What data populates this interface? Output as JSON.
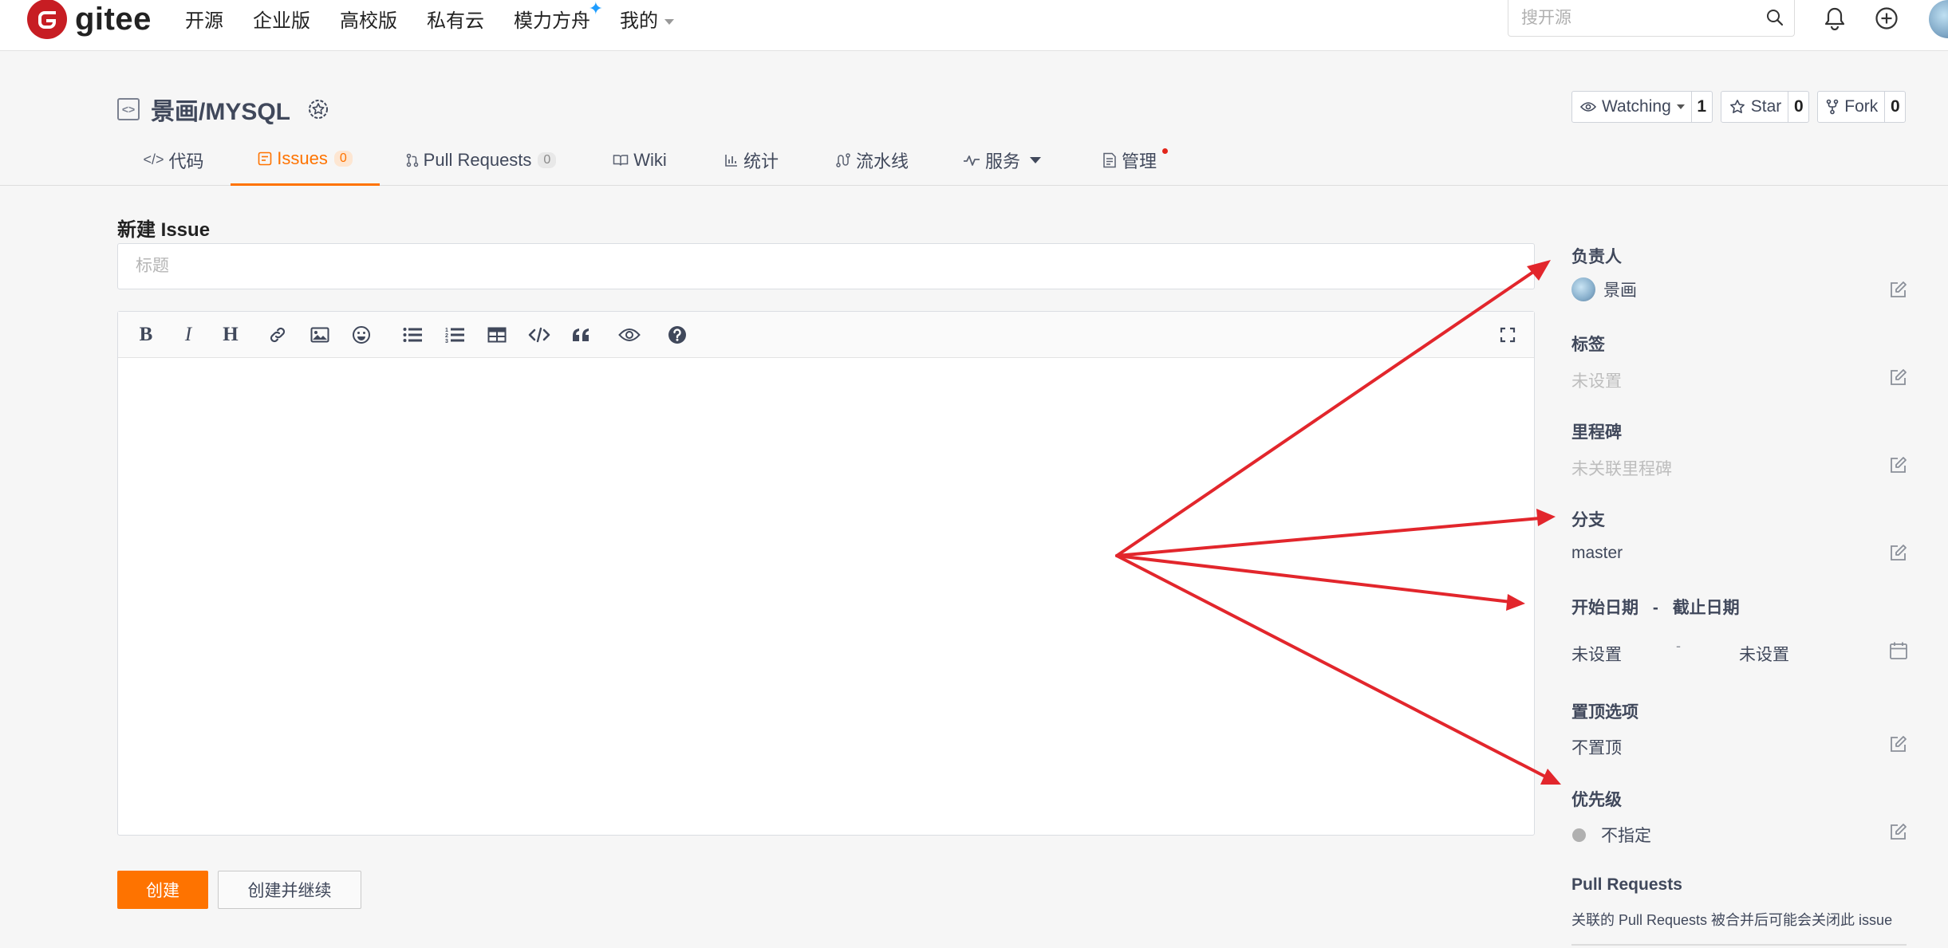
{
  "nav": {
    "logo_text": "gitee",
    "links": [
      "开源",
      "企业版",
      "高校版",
      "私有云",
      "模力方舟",
      "我的"
    ],
    "search_placeholder": "搜开源"
  },
  "repo": {
    "title": "景画/MYSQL",
    "watch_label": "Watching",
    "watch_count": "1",
    "star_label": "Star",
    "star_count": "0",
    "fork_label": "Fork",
    "fork_count": "0"
  },
  "tabs": [
    {
      "label": "代码"
    },
    {
      "label": "Issues",
      "count": "0"
    },
    {
      "label": "Pull Requests",
      "count": "0"
    },
    {
      "label": "Wiki"
    },
    {
      "label": "统计"
    },
    {
      "label": "流水线"
    },
    {
      "label": "服务"
    },
    {
      "label": "管理"
    }
  ],
  "form": {
    "heading": "新建 Issue",
    "title_placeholder": "标题",
    "create_label": "创建",
    "create_continue_label": "创建并继续"
  },
  "sidebar": {
    "assignee": {
      "label": "负责人",
      "value": "景画"
    },
    "tags": {
      "label": "标签",
      "value": "未设置"
    },
    "milestone": {
      "label": "里程碑",
      "value": "未关联里程碑"
    },
    "branch": {
      "label": "分支",
      "value": "master"
    },
    "dates": {
      "start_label": "开始日期",
      "separator": "-",
      "end_label": "截止日期",
      "start_value": "未设置",
      "end_value": "未设置"
    },
    "pin": {
      "label": "置顶选项",
      "value": "不置顶"
    },
    "priority": {
      "label": "优先级",
      "value": "不指定"
    },
    "pull_requests": {
      "label": "Pull Requests",
      "note": "关联的 Pull Requests 被合并后可能会关闭此 issue"
    }
  },
  "colors": {
    "brand": "#fe7300",
    "logo_red": "#c71d23",
    "annotation_arrow": "#e2262c"
  }
}
